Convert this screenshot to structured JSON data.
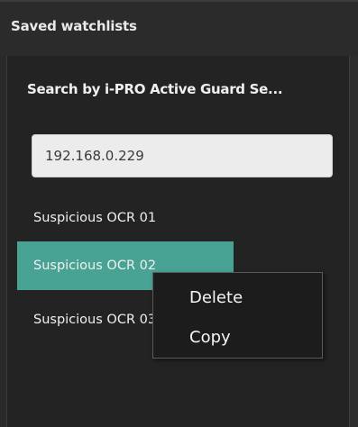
{
  "header": {
    "title": "Saved watchlists"
  },
  "panel": {
    "section_title": "Search by i-PRO Active Guard Se...",
    "search": {
      "value": "192.168.0.229"
    },
    "items": [
      {
        "label": "Suspicious OCR 01"
      },
      {
        "label": "Suspicious OCR 02"
      },
      {
        "label": "Suspicious OCR 03"
      }
    ]
  },
  "context_menu": {
    "items": [
      {
        "label": "Delete"
      },
      {
        "label": "Copy"
      }
    ]
  },
  "colors": {
    "selected": "#48a394",
    "background": "#232323"
  }
}
